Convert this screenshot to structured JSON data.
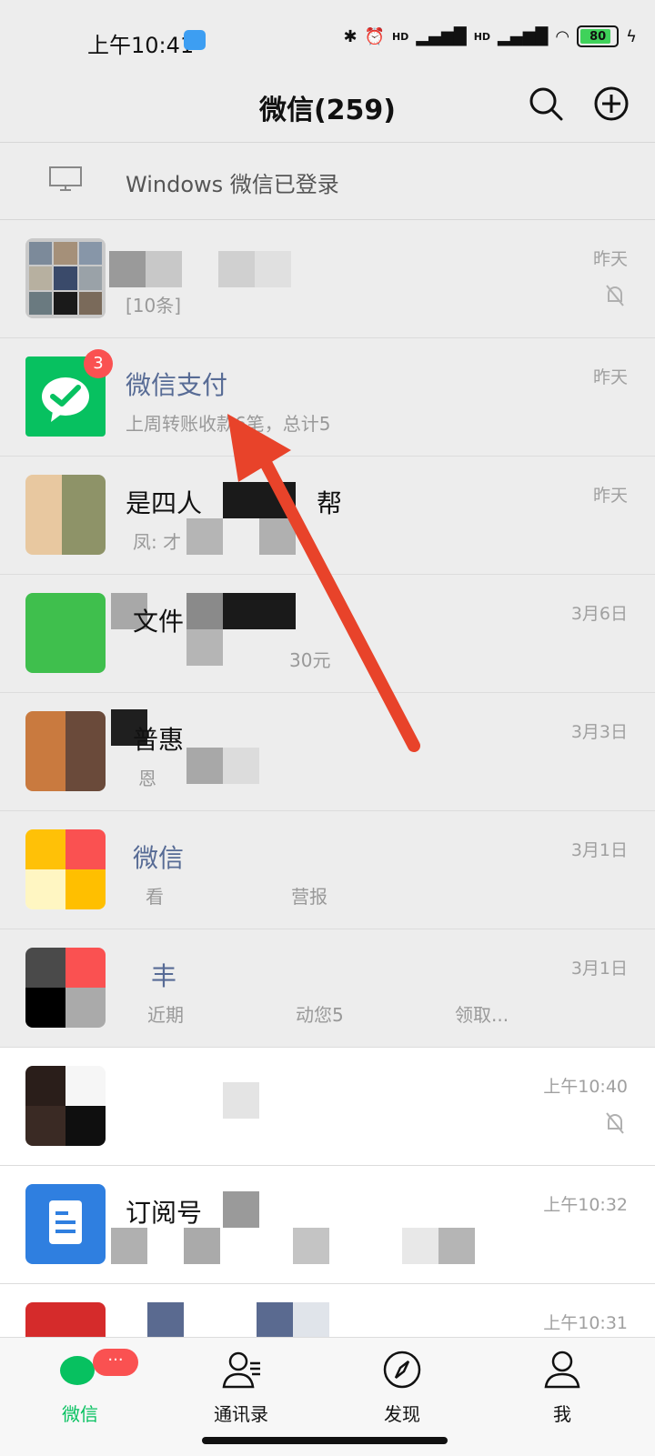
{
  "status_bar": {
    "time": "上午10:41",
    "net1": "HD",
    "net2": "HD",
    "battery": "80"
  },
  "header": {
    "title": "微信(259)"
  },
  "banner": {
    "text": "Windows 微信已登录"
  },
  "chats": [
    {
      "name": "",
      "preview": "[10条]",
      "time": "昨天",
      "muted": true
    },
    {
      "name": "微信支付",
      "preview": "上周转账收款6笔，总计5",
      "time": "昨天",
      "badge": "3"
    },
    {
      "name": "是四人",
      "name2": "帮",
      "preview": "凤: 才",
      "time": "昨天"
    },
    {
      "name": "文件",
      "preview": "30元",
      "time": "3月6日"
    },
    {
      "name": "普惠",
      "preview": "恩",
      "time": "3月3日"
    },
    {
      "name": "微信",
      "preview": "看",
      "preview2": "营报",
      "time": "3月1日"
    },
    {
      "name": "丰",
      "preview": "近期",
      "preview2": "动您5",
      "preview3": "领取...",
      "time": "3月1日"
    },
    {
      "name": "",
      "preview": "",
      "time": "上午10:40",
      "muted": true
    },
    {
      "name": "订阅号",
      "preview": "",
      "time": "上午10:32"
    },
    {
      "name": "",
      "preview": "",
      "time": "上午10:31"
    }
  ],
  "tabs": [
    {
      "label": "微信",
      "badge": "···"
    },
    {
      "label": "通讯录"
    },
    {
      "label": "发现"
    },
    {
      "label": "我"
    }
  ],
  "colors": {
    "accent": "#07c160",
    "badge": "#fa5151",
    "link_name": "#576b95",
    "arrow": "#e8432a"
  }
}
